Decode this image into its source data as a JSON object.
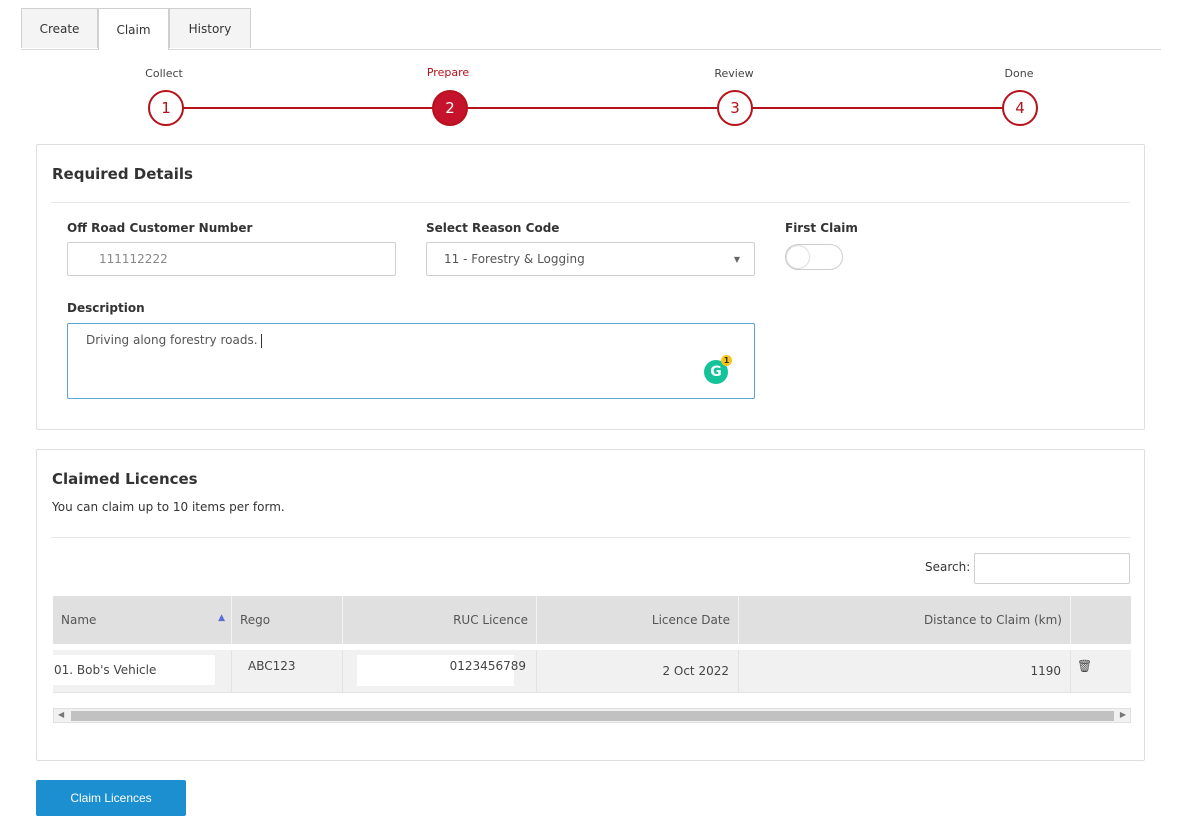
{
  "tabs": [
    "Create",
    "Claim",
    "History"
  ],
  "steps": [
    {
      "label": "Collect",
      "number": "1"
    },
    {
      "label": "Prepare",
      "number": "2"
    },
    {
      "label": "Review",
      "number": "3"
    },
    {
      "label": "Done",
      "number": "4"
    }
  ],
  "current_step": "Prepare",
  "accent_color": "#b5121b",
  "required_details": {
    "title": "Required Details",
    "customer_number_label": "Off Road Customer Number",
    "customer_number_value": "111112222",
    "reason_label": "Select Reason Code",
    "reason_value": "11 - Forestry & Logging",
    "first_claim_label": "First Claim",
    "first_claim_on": false,
    "description_label": "Description",
    "description_value": "Driving along forestry roads.",
    "grammarly_icon": "G",
    "grammarly_count": "1"
  },
  "claimed_licences": {
    "title": "Claimed Licences",
    "note": "You can claim up to 10 items per form.",
    "search_label": "Search:",
    "search_value": "",
    "columns": [
      "Name",
      "Rego",
      "RUC Licence",
      "Licence Date",
      "Distance to Claim (km)"
    ],
    "rows": [
      {
        "name": "01. Bob's Vehicle",
        "rego": "ABC123",
        "ruc_licence": "0123456789",
        "licence_date": "2 Oct 2022",
        "distance": "1190"
      }
    ]
  },
  "submit_label": "Claim Licences",
  "submit_color": "#1b8fd0"
}
